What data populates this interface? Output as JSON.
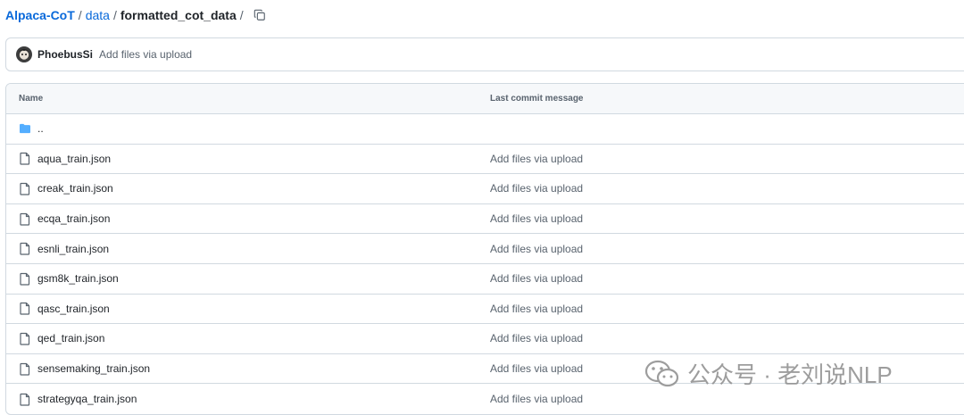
{
  "breadcrumb": {
    "repo": "Alpaca-CoT",
    "folder": "data",
    "current": "formatted_cot_data",
    "sep": "/"
  },
  "commit": {
    "author": "PhoebusSi",
    "message": "Add files via upload"
  },
  "table": {
    "headers": {
      "name": "Name",
      "message": "Last commit message"
    },
    "parent_dir": "..",
    "rows": [
      {
        "name": "aqua_train.json",
        "message": "Add files via upload"
      },
      {
        "name": "creak_train.json",
        "message": "Add files via upload"
      },
      {
        "name": "ecqa_train.json",
        "message": "Add files via upload"
      },
      {
        "name": "esnli_train.json",
        "message": "Add files via upload"
      },
      {
        "name": "gsm8k_train.json",
        "message": "Add files via upload"
      },
      {
        "name": "qasc_train.json",
        "message": "Add files via upload"
      },
      {
        "name": "qed_train.json",
        "message": "Add files via upload"
      },
      {
        "name": "sensemaking_train.json",
        "message": "Add files via upload"
      },
      {
        "name": "strategyqa_train.json",
        "message": "Add files via upload"
      }
    ]
  },
  "watermark": {
    "text": "公众号 · 老刘说NLP"
  },
  "colors": {
    "link": "#0969da",
    "folder": "#54aeff",
    "border": "#d1d9e0",
    "muted": "#59636e"
  },
  "icons": {
    "copy": "copy-icon",
    "folder": "folder-icon",
    "file": "file-icon"
  }
}
